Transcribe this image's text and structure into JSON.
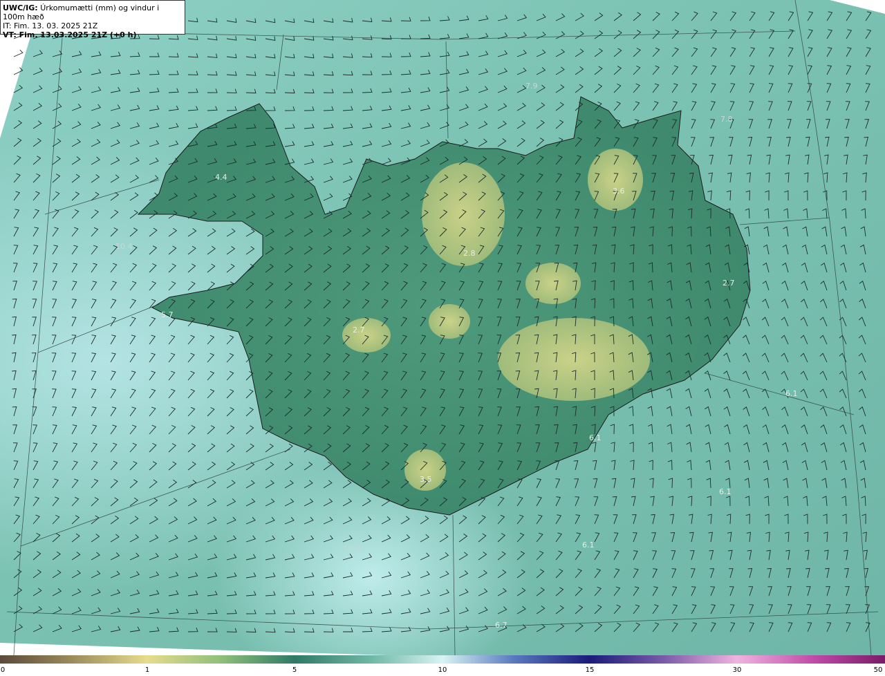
{
  "header": {
    "product": "UWC/IG:",
    "description": "Úrkomumætti (mm) og vindur i 100m hæð",
    "issue_time": "IT: Fim. 13. 03. 2025 21Z",
    "valid_time": "VT: Fim. 13.03.2025 21Z (+0 h)"
  },
  "colorbar": {
    "ticks": [
      "0",
      "1",
      "5",
      "10",
      "15",
      "30",
      "50"
    ]
  },
  "labels": [
    {
      "id": "a",
      "text": "7.9"
    },
    {
      "id": "b",
      "text": "7.8"
    },
    {
      "id": "c",
      "text": "4.4"
    },
    {
      "id": "d",
      "text": "3.6"
    },
    {
      "id": "e",
      "text": "10.4"
    },
    {
      "id": "f",
      "text": "2.8"
    },
    {
      "id": "g",
      "text": "5.7"
    },
    {
      "id": "h",
      "text": "2.7"
    },
    {
      "id": "i",
      "text": "2.7"
    },
    {
      "id": "j",
      "text": "6.1"
    },
    {
      "id": "k",
      "text": "6.1"
    },
    {
      "id": "l",
      "text": "3.5"
    },
    {
      "id": "m",
      "text": "6.1"
    },
    {
      "id": "n",
      "text": "10.6"
    },
    {
      "id": "o",
      "text": "6.7"
    },
    {
      "id": "p",
      "text": "6.1"
    }
  ]
}
